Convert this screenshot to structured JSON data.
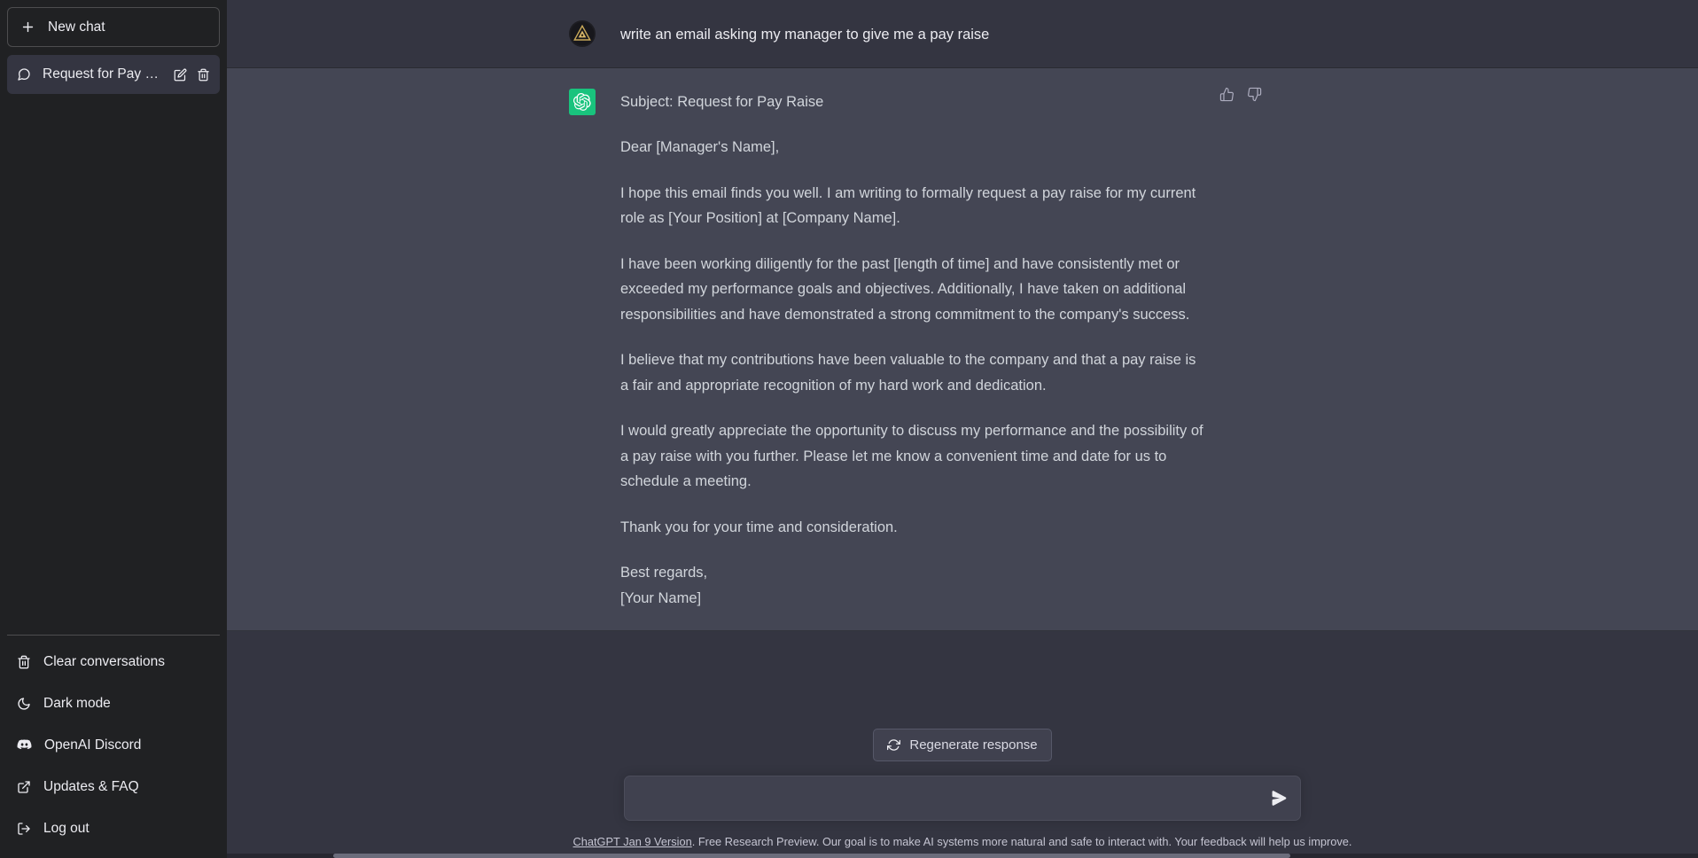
{
  "sidebar": {
    "new_chat": {
      "label": "New chat",
      "icon": "plus-icon"
    },
    "conversations": [
      {
        "title": "Request for Pay Raise",
        "icon": "message-bubble-icon",
        "active": true,
        "actions": [
          {
            "name": "edit-icon",
            "label": "Edit"
          },
          {
            "name": "delete-icon",
            "label": "Delete"
          }
        ]
      }
    ],
    "footer_items": [
      {
        "label": "Clear conversations",
        "icon": "trash-icon"
      },
      {
        "label": "Dark mode",
        "icon": "moon-icon"
      },
      {
        "label": "OpenAI Discord",
        "icon": "discord-icon"
      },
      {
        "label": "Updates & FAQ",
        "icon": "external-link-icon"
      },
      {
        "label": "Log out",
        "icon": "logout-icon"
      }
    ]
  },
  "thread": {
    "messages": [
      {
        "role": "user",
        "avatar": "user-avatar-pyramid",
        "text": "write an email asking my manager to give me a pay raise"
      },
      {
        "role": "assistant",
        "avatar": "chatgpt-logo",
        "paragraphs": [
          "Subject: Request for Pay Raise",
          "Dear [Manager's Name],",
          "I hope this email finds you well. I am writing to formally request a pay raise for my current role as [Your Position] at [Company Name].",
          "I have been working diligently for the past [length of time] and have consistently met or exceeded my performance goals and objectives. Additionally, I have taken on additional responsibilities and have demonstrated a strong commitment to the company's success.",
          "I believe that my contributions have been valuable to the company and that a pay raise is a fair and appropriate recognition of my hard work and dedication.",
          "I would greatly appreciate the opportunity to discuss my performance and the possibility of a pay raise with you further. Please let me know a convenient time and date for us to schedule a meeting.",
          "Thank you for your time and consideration.",
          "Best regards,",
          "[Your Name]"
        ],
        "feedback": [
          {
            "name": "thumbs-up-icon",
            "label": "Good response"
          },
          {
            "name": "thumbs-down-icon",
            "label": "Bad response"
          }
        ]
      }
    ]
  },
  "composer": {
    "regenerate_label": "Regenerate response",
    "regenerate_icon": "refresh-icon",
    "input_value": "",
    "input_placeholder": "",
    "send_icon": "send-arrow-icon"
  },
  "legal": {
    "link_text": "ChatGPT Jan 9 Version",
    "rest_text": ". Free Research Preview. Our goal is to make AI systems more natural and safe to interact with. Your feedback will help us improve."
  },
  "colors": {
    "sidebar_bg": "#202123",
    "user_row_bg": "#343541",
    "assistant_row_bg": "#444654",
    "accent_green": "#19c37d",
    "composer_bg": "#40414f",
    "text_primary": "#ececf1",
    "text_secondary": "#d1d5db"
  }
}
